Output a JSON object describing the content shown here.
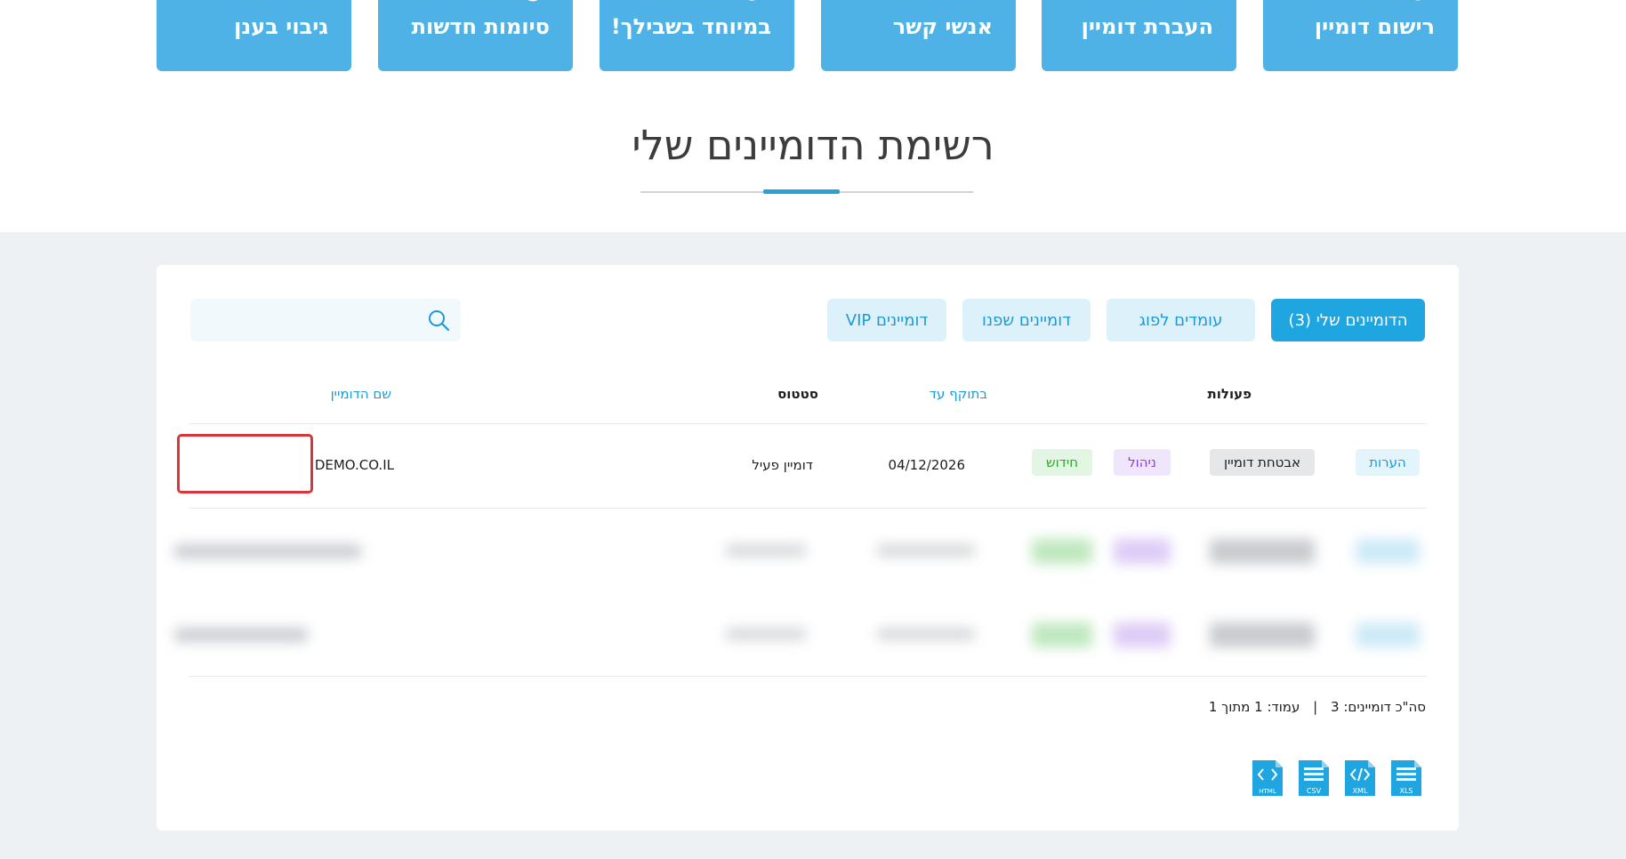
{
  "tiles": [
    {
      "label": "רישום דומיין"
    },
    {
      "label": "העברת דומיין"
    },
    {
      "label": "אנשי קשר"
    },
    {
      "label": "במיוחד בשבילך!"
    },
    {
      "label": "סיומות חדשות"
    },
    {
      "label": "גיבוי בענן"
    }
  ],
  "page_title": "רשימת הדומיינים שלי",
  "tabs": [
    {
      "label": "הדומיינים שלי (3)",
      "active": true
    },
    {
      "label": "עומדים לפוג"
    },
    {
      "label": "דומיינים שפנו"
    },
    {
      "label": "דומיינים VIP"
    }
  ],
  "search": {
    "placeholder": "",
    "value": ""
  },
  "table": {
    "headers": {
      "domain_name": "שם הדומיין",
      "status": "סטטוס",
      "valid_until": "בתוקף עד",
      "actions": "פעולות"
    },
    "rows": [
      {
        "domain": "DEMO.CO.IL",
        "status": "דומיין פעיל",
        "valid_until": "04/12/2026",
        "actions": {
          "renew": "חידוש",
          "manage": "ניהול",
          "security": "אבטחת דומיין",
          "notes": "הערות"
        }
      }
    ],
    "blurred_rows": 2
  },
  "footer": {
    "total_label": "סה\"כ דומיינים: 3",
    "separator": "|",
    "page_label": "עמוד: 1 מתוך 1"
  },
  "exports": [
    "XLS",
    "XML",
    "CSV",
    "HTML"
  ],
  "colors": {
    "tile_bg": "#4fb2e6",
    "accent": "#1fa6e0",
    "highlight": "#d9363c",
    "band_bg": "#eef1f4"
  }
}
